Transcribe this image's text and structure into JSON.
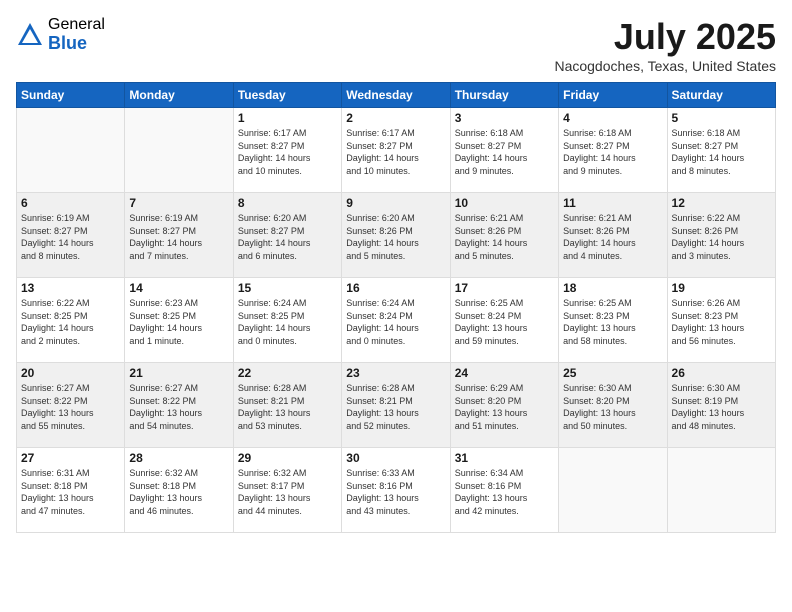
{
  "logo": {
    "general": "General",
    "blue": "Blue"
  },
  "title": {
    "month_year": "July 2025",
    "location": "Nacogdoches, Texas, United States"
  },
  "days_of_week": [
    "Sunday",
    "Monday",
    "Tuesday",
    "Wednesday",
    "Thursday",
    "Friday",
    "Saturday"
  ],
  "weeks": [
    {
      "shaded": false,
      "days": [
        {
          "num": "",
          "info": ""
        },
        {
          "num": "",
          "info": ""
        },
        {
          "num": "1",
          "info": "Sunrise: 6:17 AM\nSunset: 8:27 PM\nDaylight: 14 hours\nand 10 minutes."
        },
        {
          "num": "2",
          "info": "Sunrise: 6:17 AM\nSunset: 8:27 PM\nDaylight: 14 hours\nand 10 minutes."
        },
        {
          "num": "3",
          "info": "Sunrise: 6:18 AM\nSunset: 8:27 PM\nDaylight: 14 hours\nand 9 minutes."
        },
        {
          "num": "4",
          "info": "Sunrise: 6:18 AM\nSunset: 8:27 PM\nDaylight: 14 hours\nand 9 minutes."
        },
        {
          "num": "5",
          "info": "Sunrise: 6:18 AM\nSunset: 8:27 PM\nDaylight: 14 hours\nand 8 minutes."
        }
      ]
    },
    {
      "shaded": true,
      "days": [
        {
          "num": "6",
          "info": "Sunrise: 6:19 AM\nSunset: 8:27 PM\nDaylight: 14 hours\nand 8 minutes."
        },
        {
          "num": "7",
          "info": "Sunrise: 6:19 AM\nSunset: 8:27 PM\nDaylight: 14 hours\nand 7 minutes."
        },
        {
          "num": "8",
          "info": "Sunrise: 6:20 AM\nSunset: 8:27 PM\nDaylight: 14 hours\nand 6 minutes."
        },
        {
          "num": "9",
          "info": "Sunrise: 6:20 AM\nSunset: 8:26 PM\nDaylight: 14 hours\nand 5 minutes."
        },
        {
          "num": "10",
          "info": "Sunrise: 6:21 AM\nSunset: 8:26 PM\nDaylight: 14 hours\nand 5 minutes."
        },
        {
          "num": "11",
          "info": "Sunrise: 6:21 AM\nSunset: 8:26 PM\nDaylight: 14 hours\nand 4 minutes."
        },
        {
          "num": "12",
          "info": "Sunrise: 6:22 AM\nSunset: 8:26 PM\nDaylight: 14 hours\nand 3 minutes."
        }
      ]
    },
    {
      "shaded": false,
      "days": [
        {
          "num": "13",
          "info": "Sunrise: 6:22 AM\nSunset: 8:25 PM\nDaylight: 14 hours\nand 2 minutes."
        },
        {
          "num": "14",
          "info": "Sunrise: 6:23 AM\nSunset: 8:25 PM\nDaylight: 14 hours\nand 1 minute."
        },
        {
          "num": "15",
          "info": "Sunrise: 6:24 AM\nSunset: 8:25 PM\nDaylight: 14 hours\nand 0 minutes."
        },
        {
          "num": "16",
          "info": "Sunrise: 6:24 AM\nSunset: 8:24 PM\nDaylight: 14 hours\nand 0 minutes."
        },
        {
          "num": "17",
          "info": "Sunrise: 6:25 AM\nSunset: 8:24 PM\nDaylight: 13 hours\nand 59 minutes."
        },
        {
          "num": "18",
          "info": "Sunrise: 6:25 AM\nSunset: 8:23 PM\nDaylight: 13 hours\nand 58 minutes."
        },
        {
          "num": "19",
          "info": "Sunrise: 6:26 AM\nSunset: 8:23 PM\nDaylight: 13 hours\nand 56 minutes."
        }
      ]
    },
    {
      "shaded": true,
      "days": [
        {
          "num": "20",
          "info": "Sunrise: 6:27 AM\nSunset: 8:22 PM\nDaylight: 13 hours\nand 55 minutes."
        },
        {
          "num": "21",
          "info": "Sunrise: 6:27 AM\nSunset: 8:22 PM\nDaylight: 13 hours\nand 54 minutes."
        },
        {
          "num": "22",
          "info": "Sunrise: 6:28 AM\nSunset: 8:21 PM\nDaylight: 13 hours\nand 53 minutes."
        },
        {
          "num": "23",
          "info": "Sunrise: 6:28 AM\nSunset: 8:21 PM\nDaylight: 13 hours\nand 52 minutes."
        },
        {
          "num": "24",
          "info": "Sunrise: 6:29 AM\nSunset: 8:20 PM\nDaylight: 13 hours\nand 51 minutes."
        },
        {
          "num": "25",
          "info": "Sunrise: 6:30 AM\nSunset: 8:20 PM\nDaylight: 13 hours\nand 50 minutes."
        },
        {
          "num": "26",
          "info": "Sunrise: 6:30 AM\nSunset: 8:19 PM\nDaylight: 13 hours\nand 48 minutes."
        }
      ]
    },
    {
      "shaded": false,
      "days": [
        {
          "num": "27",
          "info": "Sunrise: 6:31 AM\nSunset: 8:18 PM\nDaylight: 13 hours\nand 47 minutes."
        },
        {
          "num": "28",
          "info": "Sunrise: 6:32 AM\nSunset: 8:18 PM\nDaylight: 13 hours\nand 46 minutes."
        },
        {
          "num": "29",
          "info": "Sunrise: 6:32 AM\nSunset: 8:17 PM\nDaylight: 13 hours\nand 44 minutes."
        },
        {
          "num": "30",
          "info": "Sunrise: 6:33 AM\nSunset: 8:16 PM\nDaylight: 13 hours\nand 43 minutes."
        },
        {
          "num": "31",
          "info": "Sunrise: 6:34 AM\nSunset: 8:16 PM\nDaylight: 13 hours\nand 42 minutes."
        },
        {
          "num": "",
          "info": ""
        },
        {
          "num": "",
          "info": ""
        }
      ]
    }
  ]
}
